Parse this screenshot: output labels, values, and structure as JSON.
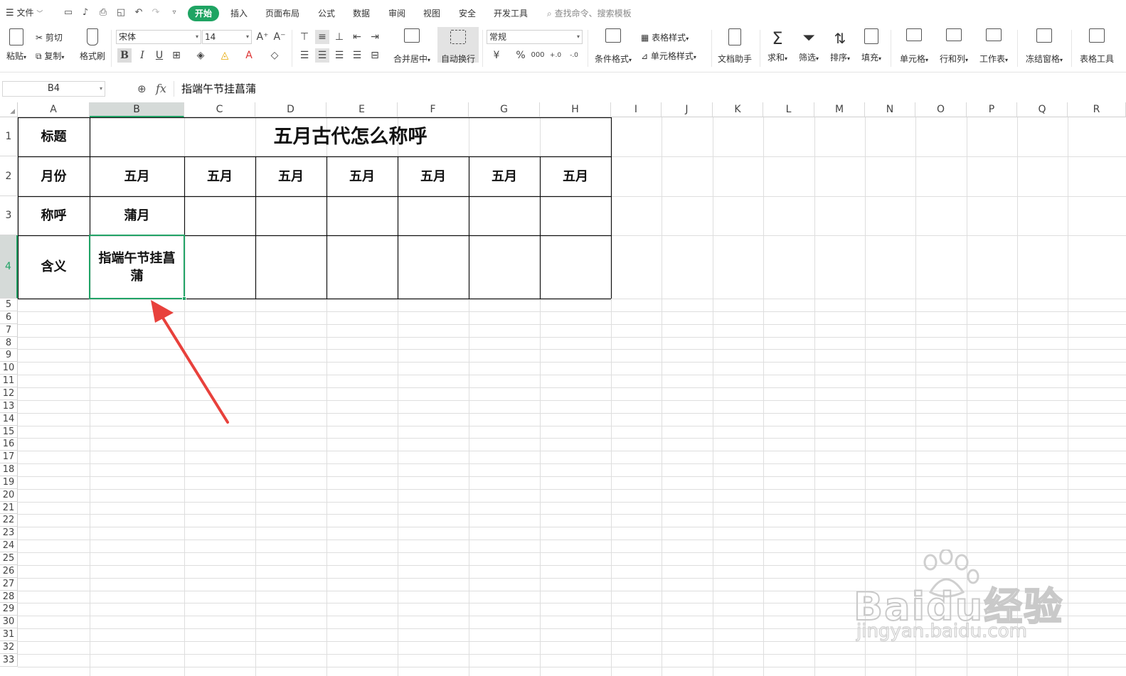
{
  "menubar": {
    "file_label": "文件",
    "tabs": [
      "开始",
      "插入",
      "页面布局",
      "公式",
      "数据",
      "审阅",
      "视图",
      "安全",
      "开发工具"
    ],
    "active_tab": "开始",
    "search_placeholder": "查找命令、搜索模板"
  },
  "ribbon": {
    "paste": "粘贴",
    "cut": "剪切",
    "copy": "复制",
    "format_painter": "格式刷",
    "font_name": "宋体",
    "font_size": "14",
    "merge_center": "合并居中",
    "wrap_text": "自动换行",
    "number_format": "常规",
    "cond_format": "条件格式",
    "table_style": "表格样式",
    "cell_style": "单元格样式",
    "doc_helper": "文档助手",
    "sum": "求和",
    "filter": "筛选",
    "sort": "排序",
    "fill": "填充",
    "cell": "单元格",
    "row_col": "行和列",
    "worksheet": "工作表",
    "freeze": "冻结窗格",
    "table_tools": "表格工具"
  },
  "formula_bar": {
    "name_box": "B4",
    "fx": "fx",
    "content": "指端午节挂菖蒲"
  },
  "columns": [
    "A",
    "B",
    "C",
    "D",
    "E",
    "F",
    "G",
    "H",
    "I",
    "J",
    "K",
    "L",
    "M",
    "N",
    "O",
    "P",
    "Q",
    "R"
  ],
  "active_col": "B",
  "rows": [
    "1",
    "2",
    "3",
    "4",
    "5",
    "6",
    "7",
    "8",
    "9",
    "10",
    "11",
    "12",
    "13",
    "14",
    "15",
    "16",
    "17",
    "18",
    "19",
    "20",
    "21",
    "22",
    "23",
    "24",
    "25",
    "26",
    "27",
    "28",
    "29",
    "30",
    "31",
    "32",
    "33"
  ],
  "active_row": "4",
  "table": {
    "a1": "标题",
    "title": "五月古代怎么称呼",
    "a2": "月份",
    "months": [
      "五月",
      "五月",
      "五月",
      "五月",
      "五月",
      "五月",
      "五月"
    ],
    "a3": "称呼",
    "b3": "蒲月",
    "a4": "含义",
    "b4": "指端午节挂菖蒲"
  },
  "colors": {
    "accent": "#21a366",
    "active_pill": "#1fa463",
    "arrow": "#e8413c"
  },
  "watermark": {
    "brand": "Baidu经验",
    "url": "jingyan.baidu.com"
  }
}
